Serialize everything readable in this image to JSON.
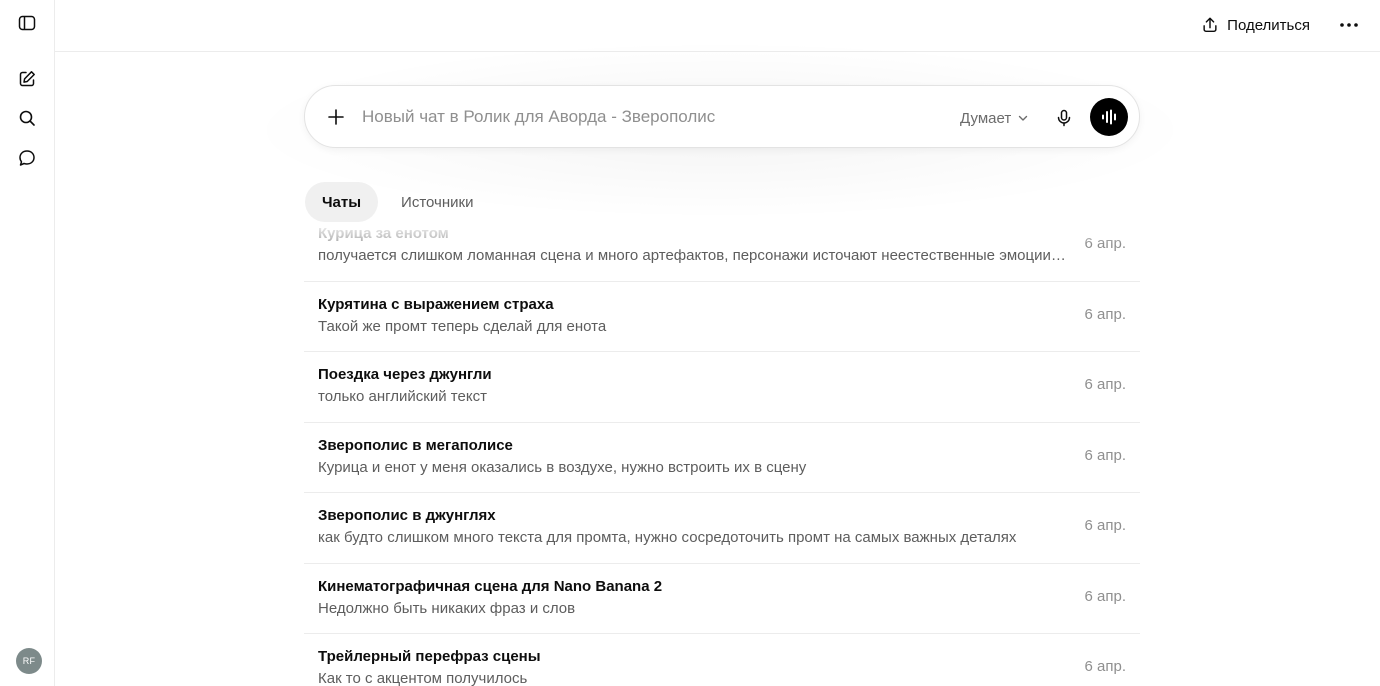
{
  "header": {
    "share_label": "Поделиться"
  },
  "composer": {
    "placeholder": "Новый чат в Ролик для Аворда - Зверополис",
    "model_label": "Думает"
  },
  "tabs": [
    {
      "label": "Чаты",
      "active": true
    },
    {
      "label": "Источники",
      "active": false
    }
  ],
  "user": {
    "initials": "RF"
  },
  "chats": [
    {
      "title": "Курица за енотом",
      "snippet": "получается слишком ломанная сцена и много артефактов, персонажи источают неестественные эмоции и выглядят странно",
      "date": "6 апр."
    },
    {
      "title": "Курятина с выражением страха",
      "snippet": "Такой же промт теперь сделай для енота",
      "date": "6 апр."
    },
    {
      "title": "Поездка через джунгли",
      "snippet": "только английский текст",
      "date": "6 апр."
    },
    {
      "title": "Зверополис в мегаполисе",
      "snippet": "Курица и енот у меня оказались в воздухе, нужно встроить их в сцену",
      "date": "6 апр."
    },
    {
      "title": "Зверополис в джунглях",
      "snippet": "как будто слишком много текста для промта, нужно сосредоточить промт на самых важных деталях",
      "date": "6 апр."
    },
    {
      "title": "Кинематографичная сцена для Nano Banana 2",
      "snippet": "Недолжно быть никаких фраз и слов",
      "date": "6 апр."
    },
    {
      "title": "Трейлерный перефраз сцены",
      "snippet": "Как то с акцентом получилось",
      "date": "6 апр."
    }
  ]
}
